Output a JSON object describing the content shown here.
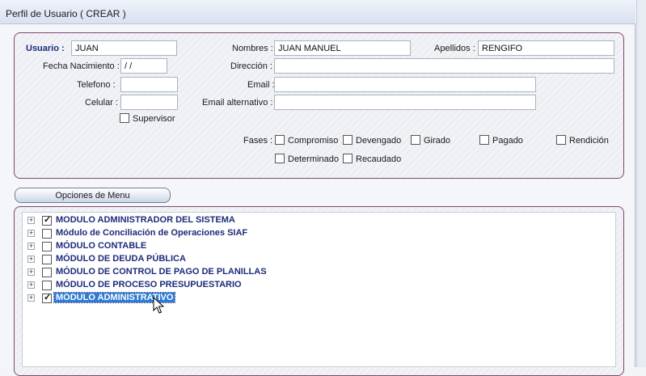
{
  "window": {
    "title": "Perfil de Usuario ( CREAR )"
  },
  "form": {
    "usuario_label": "Usuario :",
    "usuario_value": "JUAN",
    "nombres_label": "Nombres :",
    "nombres_value": "JUAN MANUEL",
    "apellidos_label": "Apellidos :",
    "apellidos_value": "RENGIFO",
    "fecha_label": "Fecha Nacimiento :",
    "fecha_value": " / /",
    "direccion_label": "Dirección :",
    "direccion_value": "",
    "telefono_label": "Telefono :",
    "telefono_value": "",
    "email_label": "Email :",
    "email_value": "",
    "celular_label": "Celular :",
    "celular_value": "",
    "email_alt_label": "Email  alternativo :",
    "email_alt_value": "",
    "supervisor_label": "Supervisor",
    "supervisor_checked": false,
    "fases_label": "Fases :",
    "fases": [
      {
        "label": "Compromiso",
        "checked": false
      },
      {
        "label": "Devengado",
        "checked": false
      },
      {
        "label": "Girado",
        "checked": false
      },
      {
        "label": "Pagado",
        "checked": false
      },
      {
        "label": "Rendición",
        "checked": false
      },
      {
        "label": "Determinado",
        "checked": false
      },
      {
        "label": "Recaudado",
        "checked": false
      }
    ]
  },
  "menu": {
    "tab_label": "Opciones de Menu",
    "items": [
      {
        "label": "MODULO ADMINISTRADOR DEL SISTEMA",
        "checked": true,
        "selected": false
      },
      {
        "label": "Módulo de Conciliación de Operaciones SIAF",
        "checked": false,
        "selected": false
      },
      {
        "label": "MÓDULO CONTABLE",
        "checked": false,
        "selected": false
      },
      {
        "label": "MÓDULO DE DEUDA PÚBLICA",
        "checked": false,
        "selected": false
      },
      {
        "label": "MÓDULO DE CONTROL DE PAGO DE PLANILLAS",
        "checked": false,
        "selected": false
      },
      {
        "label": "MÓDULO DE PROCESO PRESUPUESTARIO",
        "checked": false,
        "selected": false
      },
      {
        "label": "MÓDULO ADMINISTRATIVO",
        "checked": true,
        "selected": true
      }
    ]
  }
}
